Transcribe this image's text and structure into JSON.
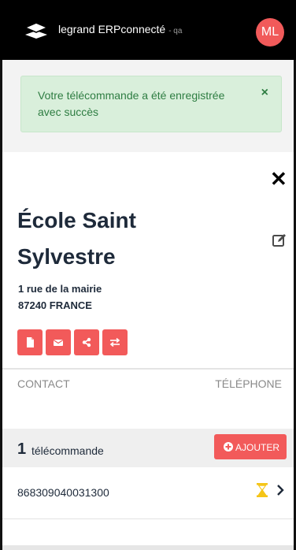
{
  "header": {
    "brand": "legrand ERPconnecté",
    "env": "- qa",
    "avatar": "ML",
    "logo_icon": "stacked-layers-icon"
  },
  "alert": {
    "message": "Votre télécommande a été enregistrée avec succès",
    "close": "×"
  },
  "panel": {
    "close": "✕",
    "name": "École Saint Sylvestre",
    "address_line1": "1 rue de la mairie",
    "address_line2": "87240 FRANCE",
    "edit_icon": "edit-icon",
    "actions": [
      "file-icon",
      "mail-icon",
      "share-icon",
      "transfer-icon"
    ]
  },
  "contacts": {
    "col_contact": "CONTACT",
    "col_phone": "TÉLÉPHONE"
  },
  "remotes": {
    "count": "1",
    "label": "télécommande",
    "add_label": "AJOUTER",
    "items": [
      {
        "id": "868309040031300",
        "status_icon": "hourglass-icon"
      }
    ]
  },
  "colors": {
    "accent": "#f25a5a",
    "success_bg": "#d9efdb",
    "success_text": "#2e7d42",
    "pending": "#f5c518"
  }
}
